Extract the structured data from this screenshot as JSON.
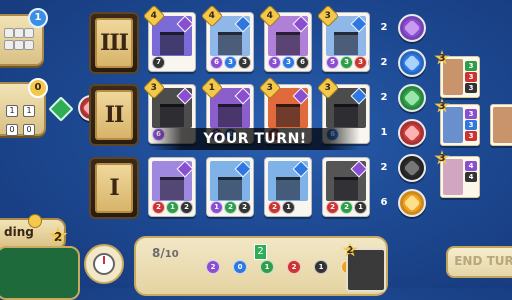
{
  "left_panel": {
    "top_player_badge": "1",
    "mid_player_badge": "0",
    "mid_chips": [
      "1",
      "1",
      "0",
      "0"
    ],
    "bottom_label": "ding",
    "bottom_badge": "2"
  },
  "levels": [
    "III",
    "II",
    "I"
  ],
  "cards": {
    "row3": [
      {
        "points": "4",
        "gem": "#8a4fd1",
        "art": "#7a6bd6",
        "costs": [
          {
            "c": "#333",
            "v": "7"
          }
        ]
      },
      {
        "points": "4",
        "gem": "#2f78e0",
        "art": "#8fb7e8",
        "costs": [
          {
            "c": "#8a4fd1",
            "v": "6"
          },
          {
            "c": "#2f78e0",
            "v": "3"
          },
          {
            "c": "#333",
            "v": "3"
          }
        ]
      },
      {
        "points": "4",
        "gem": "#8a4fd1",
        "art": "#b07fd8",
        "costs": [
          {
            "c": "#8a4fd1",
            "v": "3"
          },
          {
            "c": "#2f78e0",
            "v": "3"
          },
          {
            "c": "#333",
            "v": "6"
          }
        ]
      },
      {
        "points": "3",
        "gem": "#2f78e0",
        "art": "#8fb7e8",
        "costs": [
          {
            "c": "#8a4fd1",
            "v": "5"
          },
          {
            "c": "#2f9e4a",
            "v": "3"
          },
          {
            "c": "#c33",
            "v": "3"
          },
          {
            "c": "#333",
            "v": "3"
          }
        ]
      }
    ],
    "row2": [
      {
        "points": "3",
        "gem": "#8a4fd1",
        "art": "#4c4c4c",
        "costs": [
          {
            "c": "#8a4fd1",
            "v": "6"
          }
        ]
      },
      {
        "points": "1",
        "gem": "#8a4fd1",
        "art": "#8a5fcc",
        "costs": [
          {
            "c": "#8a4fd1",
            "v": "3"
          },
          {
            "c": "#2f78e0",
            "v": "2"
          }
        ]
      },
      {
        "points": "3",
        "gem": "#8a4fd1",
        "art": "#e06a3b",
        "costs": [
          {
            "c": "#c33",
            "v": "6"
          }
        ]
      },
      {
        "points": "3",
        "gem": "#2f78e0",
        "art": "#4c4c4c",
        "costs": [
          {
            "c": "#2f78e0",
            "v": "6"
          }
        ]
      }
    ],
    "row1": [
      {
        "points": "",
        "gem": "#8a4fd1",
        "art": "#9f88e0",
        "costs": [
          {
            "c": "#c33",
            "v": "2"
          },
          {
            "c": "#2f9e4a",
            "v": "1"
          },
          {
            "c": "#333",
            "v": "2"
          }
        ]
      },
      {
        "points": "",
        "gem": "#2f78e0",
        "art": "#7fb3e8",
        "costs": [
          {
            "c": "#8a4fd1",
            "v": "1"
          },
          {
            "c": "#2f9e4a",
            "v": "2"
          },
          {
            "c": "#333",
            "v": "2"
          }
        ]
      },
      {
        "points": "",
        "gem": "#2f78e0",
        "art": "#7fb3e8",
        "costs": [
          {
            "c": "#c33",
            "v": "2"
          },
          {
            "c": "#333",
            "v": "1"
          }
        ]
      },
      {
        "points": "",
        "gem": "#8a4fd1",
        "art": "#555555",
        "costs": [
          {
            "c": "#c33",
            "v": "2"
          },
          {
            "c": "#2f9e4a",
            "v": "2"
          },
          {
            "c": "#333",
            "v": "1"
          }
        ]
      }
    ]
  },
  "banner_text": "YOUR TURN!",
  "chips": [
    {
      "count": "2",
      "color": "#8a4fd1",
      "gem": "#c89bf0"
    },
    {
      "count": "2",
      "color": "#2f78e0",
      "gem": "#a9d2ff"
    },
    {
      "count": "2",
      "color": "#2f9e4a",
      "gem": "#9be5ad"
    },
    {
      "count": "1",
      "color": "#c33b3b",
      "gem": "#ffb0b0"
    },
    {
      "count": "2",
      "color": "#2a2a2a",
      "gem": "#777"
    },
    {
      "count": "6",
      "color": "#f0a020",
      "gem": "#ffe08a"
    }
  ],
  "nobles": [
    {
      "points": "3",
      "face": "#c9936c",
      "req": [
        {
          "c": "#2f9e4a",
          "v": "3"
        },
        {
          "c": "#c33",
          "v": "3"
        },
        {
          "c": "#333",
          "v": "3"
        }
      ]
    },
    {
      "points": "3",
      "face": "#6a8fcf",
      "req": [
        {
          "c": "#8a4fd1",
          "v": "3"
        },
        {
          "c": "#2f78e0",
          "v": "3"
        },
        {
          "c": "#c33",
          "v": "3"
        }
      ]
    },
    {
      "points": "3",
      "face": "#d0a6c0",
      "req": [
        {
          "c": "#8a4fd1",
          "v": "4"
        },
        {
          "c": "#333",
          "v": "4"
        }
      ]
    }
  ],
  "tray": {
    "gem_count": "8",
    "gem_limit": "10",
    "bonus_top": "2",
    "bonuses": [
      {
        "c": "#8a4fd1",
        "v": "2"
      },
      {
        "c": "#2f78e0",
        "v": "0"
      },
      {
        "c": "#2f9e4a",
        "v": "1"
      },
      {
        "c": "#c33",
        "v": "2"
      },
      {
        "c": "#333",
        "v": "1"
      },
      {
        "c": "#f0a020",
        "v": "0"
      }
    ],
    "deck_points": "2",
    "end_turn_label": "END TUR"
  }
}
